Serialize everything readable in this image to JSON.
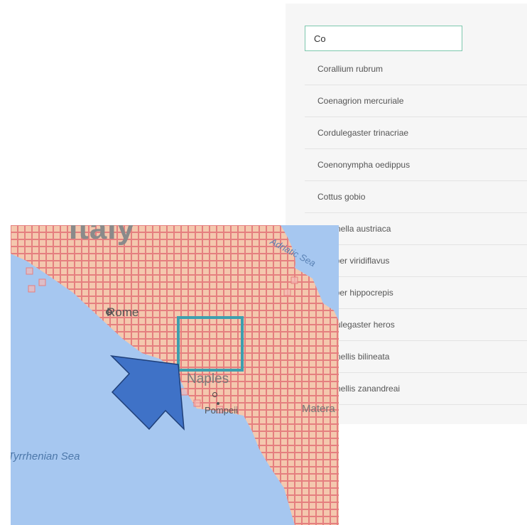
{
  "search": {
    "value": "Co"
  },
  "suggestions": [
    "Corallium rubrum",
    "Coenagrion mercuriale",
    "Cordulegaster trinacriae",
    "Coenonympha oedippus",
    "Cottus gobio",
    "Coronella austriaca",
    "Coluber viridiflavus",
    "Coluber hippocrepis",
    "Cordulegaster heros",
    "Coronellis bilineata",
    "Coronellis zanandreai"
  ],
  "map": {
    "labels": {
      "country": "Italy",
      "rome": "Rome",
      "naples": "Naples",
      "pompeii": "Pompeii",
      "matera": "Matera",
      "tyrrhenian": "Tyrrhenian Sea",
      "adriatic": "Adriatic Sea"
    },
    "colors": {
      "sea": "#a6c7f0",
      "land": "#f1d9a4",
      "grid_fill": "#f5b9b5",
      "grid_line": "#e57f7f",
      "highlight": "#3e9fae",
      "arrow": "#3f72c7"
    }
  }
}
